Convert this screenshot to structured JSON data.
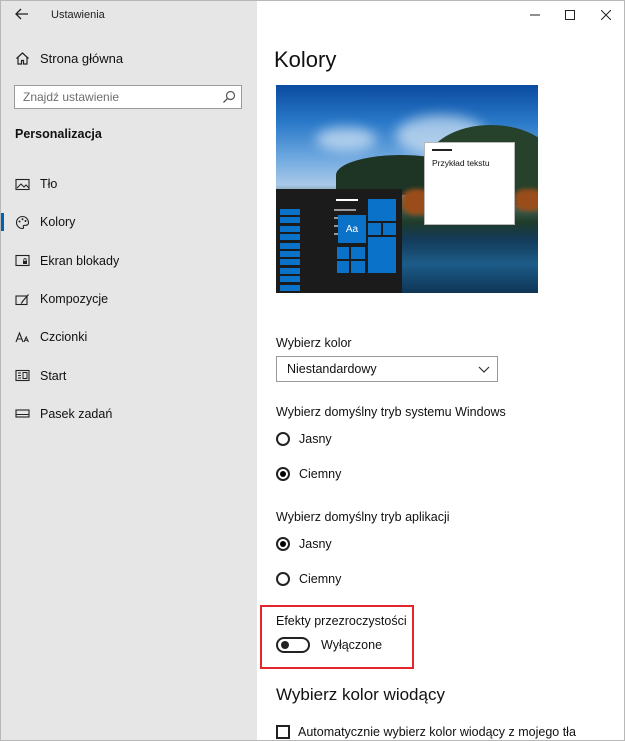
{
  "window": {
    "title": "Ustawienia",
    "controls": [
      "minimize-icon",
      "maximize-icon",
      "close-icon"
    ]
  },
  "sidebar": {
    "home_label": "Strona główna",
    "search": {
      "placeholder": "Znajdź ustawienie"
    },
    "section": "Personalizacja",
    "items": [
      {
        "label": "Tło",
        "icon": "image-icon",
        "active": false
      },
      {
        "label": "Kolory",
        "icon": "palette-icon",
        "active": true
      },
      {
        "label": "Ekran blokady",
        "icon": "lock-screen-icon",
        "active": false
      },
      {
        "label": "Kompozycje",
        "icon": "themes-icon",
        "active": false
      },
      {
        "label": "Czcionki",
        "icon": "fonts-icon",
        "active": false
      },
      {
        "label": "Start",
        "icon": "start-icon",
        "active": false
      },
      {
        "label": "Pasek zadań",
        "icon": "taskbar-icon",
        "active": false
      }
    ]
  },
  "main": {
    "title": "Kolory",
    "preview": {
      "sample_text": "Przykład tekstu",
      "tile_text": "Aa"
    },
    "choose_color": {
      "label": "Wybierz kolor",
      "value": "Niestandardowy"
    },
    "windows_mode": {
      "label": "Wybierz domyślny tryb systemu Windows",
      "options": [
        "Jasny",
        "Ciemny"
      ],
      "selected": "Ciemny"
    },
    "app_mode": {
      "label": "Wybierz domyślny tryb aplikacji",
      "options": [
        "Jasny",
        "Ciemny"
      ],
      "selected": "Jasny"
    },
    "transparency": {
      "label": "Efekty przezroczystości",
      "state": "Wyłączone",
      "on": false
    },
    "accent": {
      "title": "Wybierz kolor wiodący",
      "auto_label": "Automatycznie wybierz kolor wiodący z mojego tła",
      "checked": false
    }
  },
  "colors": {
    "accent": "#0a72c9",
    "highlight_border": "#e3262b",
    "sidebar_bg": "#e6e6e6"
  }
}
